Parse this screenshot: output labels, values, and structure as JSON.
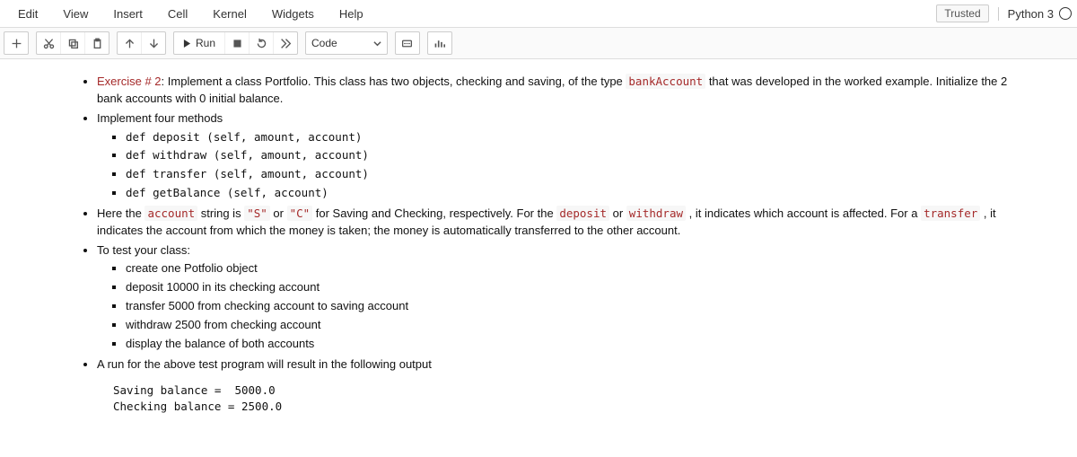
{
  "menubar": {
    "items": [
      "Edit",
      "View",
      "Insert",
      "Cell",
      "Kernel",
      "Widgets",
      "Help"
    ],
    "trusted": "Trusted",
    "kernel": "Python 3"
  },
  "toolbar": {
    "run_label": "Run",
    "celltype": "Code"
  },
  "cell": {
    "b0_lead": "Exercise # 2",
    "b0_rest_a": ": Implement a class Portfolio. This class has two objects, checking and saving, of the type ",
    "b0_code": "bankAccount",
    "b0_rest_b": " that was developed in the worked example. Initialize the 2 bank accounts with 0 initial balance.",
    "b1": "Implement four methods",
    "meth1": "def deposit (self, amount, account)",
    "meth2": "def withdraw (self, amount, account)",
    "meth3": "def transfer (self, amount, account)",
    "meth4": "def getBalance (self, account)",
    "b2_a": "Here the ",
    "b2_c1": "account",
    "b2_b": " string is ",
    "b2_c2": "\"S\"",
    "b2_c": " or ",
    "b2_c3": "\"C\"",
    "b2_d": " for Saving and Checking, respectively. For the ",
    "b2_c4": "deposit",
    "b2_e": " or ",
    "b2_c5": "withdraw",
    "b2_f": " , it indicates which account is affected. For a ",
    "b2_c6": "transfer",
    "b2_g": " , it indicates the account from which the money is taken; the money is automatically transferred to the other account.",
    "b3": "To test your class:",
    "t1": "create one Potfolio object",
    "t2": "deposit 10000 in its checking account",
    "t3": "transfer 5000 from checking account to saving account",
    "t4": "withdraw 2500 from checking account",
    "t5": "display the balance of both accounts",
    "b4": "A run for the above test program will result in the following output",
    "output": "Saving balance =  5000.0\nChecking balance = 2500.0"
  }
}
